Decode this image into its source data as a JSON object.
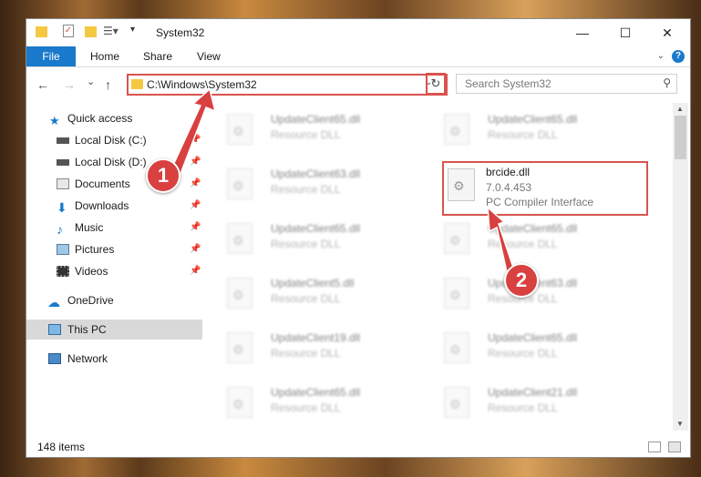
{
  "window": {
    "title": "System32",
    "controls": {
      "minimize": "—",
      "maximize": "☐",
      "close": "✕"
    }
  },
  "ribbon": {
    "tabs": [
      {
        "label": "File"
      },
      {
        "label": "Home"
      },
      {
        "label": "Share"
      },
      {
        "label": "View"
      }
    ],
    "help_label": "?"
  },
  "nav": {
    "back": "←",
    "forward": "→",
    "recent": "⌄",
    "up": "↑",
    "address": "C:\\Windows\\System32",
    "address_dropdown": "⌄",
    "refresh": "↻"
  },
  "search": {
    "placeholder": "Search System32",
    "icon": "search-icon"
  },
  "sidebar": {
    "items": [
      {
        "label": "Quick access",
        "icon": "star-icon",
        "pinned": false
      },
      {
        "label": "Local Disk (C:)",
        "icon": "drive-icon",
        "pinned": true
      },
      {
        "label": "Local Disk (D:)",
        "icon": "drive-icon",
        "pinned": true
      },
      {
        "label": "Documents",
        "icon": "documents-icon",
        "pinned": true
      },
      {
        "label": "Downloads",
        "icon": "download-icon",
        "pinned": true
      },
      {
        "label": "Music",
        "icon": "music-icon",
        "pinned": true
      },
      {
        "label": "Pictures",
        "icon": "pictures-icon",
        "pinned": true
      },
      {
        "label": "Videos",
        "icon": "videos-icon",
        "pinned": true
      },
      {
        "label": "OneDrive",
        "icon": "cloud-icon",
        "pinned": false
      },
      {
        "label": "This PC",
        "icon": "computer-icon",
        "pinned": false,
        "selected": true
      },
      {
        "label": "Network",
        "icon": "network-icon",
        "pinned": false
      }
    ],
    "pin_glyph": "📌"
  },
  "files": {
    "left_column": [
      {
        "name": "UpdateClient65.dll",
        "type": "Resource DLL"
      },
      {
        "name": "UpdateClient63.dll",
        "type": "Resource DLL"
      },
      {
        "name": "UpdateClient65.dll",
        "type": "Resource DLL"
      },
      {
        "name": "UpdateClient5.dll",
        "type": "Resource DLL"
      },
      {
        "name": "UpdateClient19.dll",
        "type": "Resource DLL"
      },
      {
        "name": "UpdateClient65.dll",
        "type": "Resource DLL"
      }
    ],
    "right_column": [
      {
        "name": "UpdateClient65.dll",
        "type": "Resource DLL"
      },
      {
        "name": "brcide.dll",
        "version": "7.0.4.453",
        "type": "PC Compiler Interface",
        "highlighted": true
      },
      {
        "name": "UpdateClient65.dll",
        "type": "Resource DLL"
      },
      {
        "name": "UpdateClient63.dll",
        "type": "Resource DLL"
      },
      {
        "name": "UpdateClient65.dll",
        "type": "Resource DLL"
      },
      {
        "name": "UpdateClient21.dll",
        "type": "Resource DLL"
      }
    ]
  },
  "status": {
    "item_count": "148 items"
  },
  "callouts": [
    {
      "label": "1"
    },
    {
      "label": "2"
    }
  ],
  "colors": {
    "accent": "#1979ca",
    "highlight": "#d9534f",
    "callout": "#d94040"
  }
}
